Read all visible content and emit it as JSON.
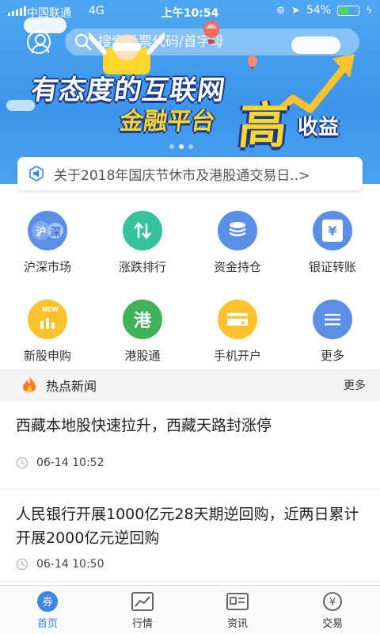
{
  "status_bar": {
    "carrier": "中国联通",
    "network": "4G",
    "time": "上午10:54",
    "battery_percent": "54%",
    "battery_level": 0.54
  },
  "search": {
    "placeholder": "搜索股票代码/首字母"
  },
  "banner": {
    "line1": "有态度的互联网",
    "line2": "金融平台",
    "big_char": "高",
    "suffix": "收益",
    "slide_index": 2,
    "slide_count": 3
  },
  "notice": {
    "text": "关于2018年国庆节休市及港股通交易日..>"
  },
  "grid": [
    {
      "label": "沪深市场",
      "icon": "shanghai-shenzhen-icon",
      "glyph": "沪",
      "color": "#5b8ee8"
    },
    {
      "label": "涨跌排行",
      "icon": "up-down-arrows-icon",
      "glyph": "⇅",
      "color": "#34c39a"
    },
    {
      "label": "资金持仓",
      "icon": "coin-stack-icon",
      "glyph": "≡",
      "color": "#5b8ee8"
    },
    {
      "label": "银证转账",
      "icon": "yen-card-icon",
      "glyph": "¥",
      "color": "#5b8ee8"
    },
    {
      "label": "新股申购",
      "icon": "new-stock-icon",
      "glyph": "NEW",
      "color": "#ffc22d"
    },
    {
      "label": "港股通",
      "icon": "hk-stock-icon",
      "glyph": "港",
      "color": "#3fb25a"
    },
    {
      "label": "手机开户",
      "icon": "card-icon",
      "glyph": "▭",
      "color": "#ffc22d"
    },
    {
      "label": "更多",
      "icon": "menu-icon",
      "glyph": "≡",
      "color": "#5b8ee8"
    }
  ],
  "news": {
    "title": "热点新闻",
    "more": "更多",
    "items": [
      {
        "title": "西藏本地股快速拉升，西藏天路封涨停",
        "date": "06-14 10:52"
      },
      {
        "title": "人民银行开展1000亿元28天期逆回购，近两日累计开展2000亿元逆回购",
        "date": "06-14 10:50"
      }
    ]
  },
  "tabs": [
    {
      "label": "首页",
      "icon": "home-coupon-icon",
      "active": true
    },
    {
      "label": "行情",
      "icon": "chart-icon",
      "active": false
    },
    {
      "label": "资讯",
      "icon": "news-icon",
      "active": false
    },
    {
      "label": "交易",
      "icon": "yen-trade-icon",
      "active": false
    }
  ],
  "colors": {
    "primary": "#3a85e6",
    "banner_blue": "#3c95ec",
    "gold": "#ffd52e"
  }
}
